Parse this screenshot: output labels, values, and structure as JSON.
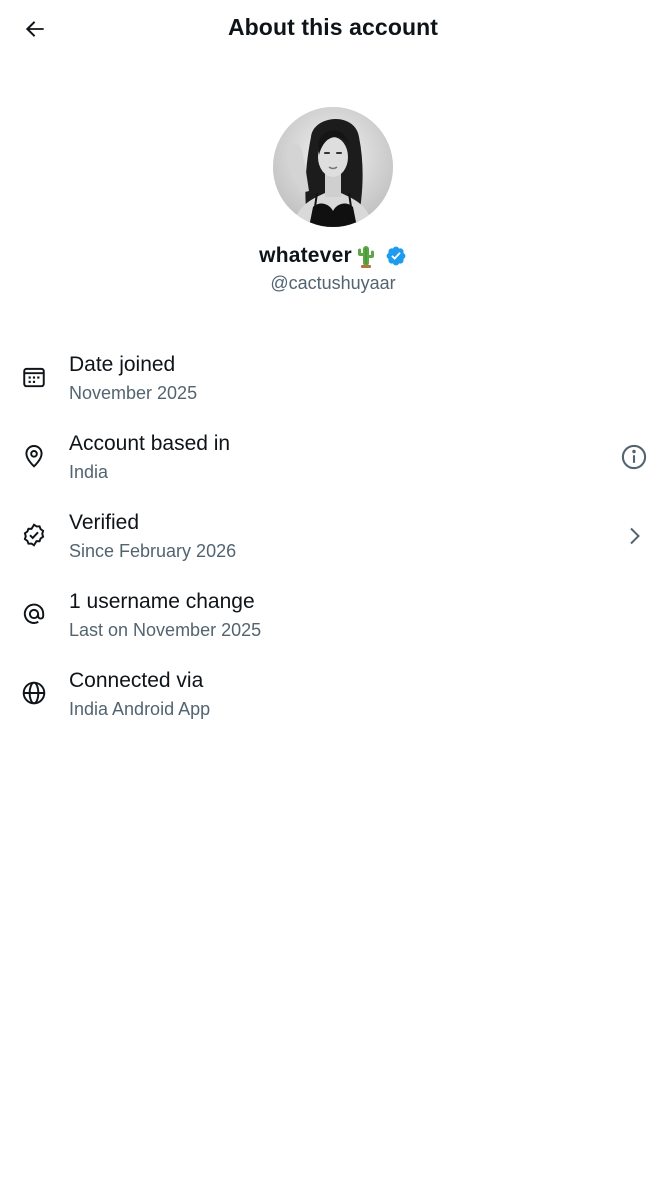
{
  "header": {
    "title": "About this account",
    "back_icon": "arrow-left-icon"
  },
  "profile": {
    "display_name": "whatever",
    "name_emoji": "cactus",
    "verified": true,
    "badge_color": "#1d9bf0",
    "handle": "@cactushuyaar"
  },
  "info": {
    "date_joined": {
      "icon": "calendar-icon",
      "title": "Date joined",
      "value": "November 2025"
    },
    "account_based": {
      "icon": "location-pin-icon",
      "title": "Account based in",
      "value": "India",
      "action_icon": "info-icon"
    },
    "verified": {
      "icon": "verified-badge-icon",
      "title": "Verified",
      "value": "Since February 2026",
      "action_icon": "chevron-right-icon"
    },
    "username_change": {
      "icon": "at-sign-icon",
      "title": "1 username change",
      "value": "Last on November 2025"
    },
    "connected_via": {
      "icon": "globe-icon",
      "title": "Connected via",
      "value": "India Android App"
    }
  },
  "colors": {
    "primary_text": "#0f1419",
    "secondary_text": "#536471",
    "accent": "#1d9bf0"
  }
}
